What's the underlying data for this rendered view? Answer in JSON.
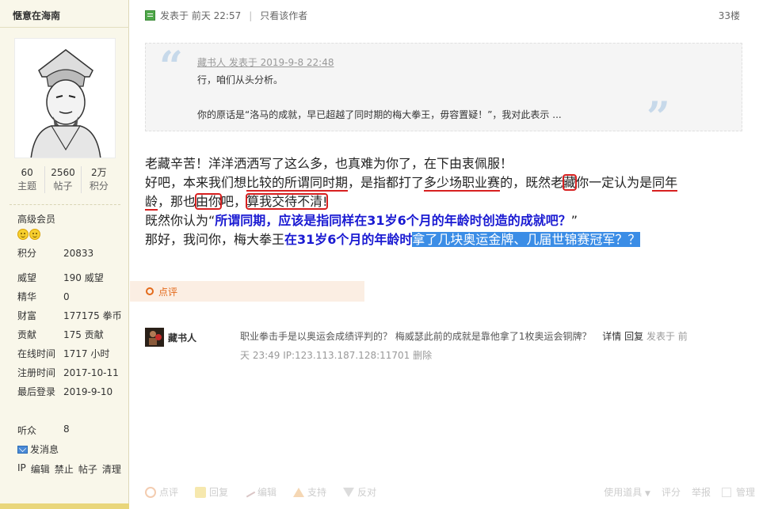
{
  "sidebar": {
    "username": "惬意在海南",
    "stats": [
      {
        "num": "60",
        "label": "主题"
      },
      {
        "num": "2560",
        "label": "帖子"
      },
      {
        "num": "2万",
        "label": "积分"
      }
    ],
    "level": "高级会员",
    "info": [
      {
        "k": "积分",
        "v": "20833"
      },
      {
        "k": "威望",
        "v": "190 威望"
      },
      {
        "k": "精华",
        "v": "0"
      },
      {
        "k": "财富",
        "v": "177175 拳币"
      },
      {
        "k": "贡献",
        "v": "175 贡献"
      },
      {
        "k": "在线时间",
        "v": "1717 小时"
      },
      {
        "k": "注册时间",
        "v": "2017-10-11"
      },
      {
        "k": "最后登录",
        "v": "2019-9-10"
      }
    ],
    "listeners": {
      "k": "听众",
      "v": "8"
    },
    "send_message": "发消息",
    "admin_links": [
      "IP",
      "编辑",
      "禁止",
      "帖子",
      "清理"
    ]
  },
  "post": {
    "posted_at": "发表于 前天 22:57",
    "only_author": "只看该作者",
    "floor": "33楼",
    "quote": {
      "header": "藏书人 发表于 2019-9-8 22:48",
      "line1": "行，咱们从头分析。",
      "line2": "你的原话是“洛马的成就，早已超越了同时期的梅大拳王，毋容置疑！”，我对此表示 ..."
    },
    "body": {
      "l1": "老藏辛苦！洋洋洒洒写了这么多，也真难为你了，在下由衷佩服！",
      "l2_a": "好吧，本来我们想",
      "l2_b": "比较的所谓同时期",
      "l2_c": "，是指都打了",
      "l2_d": "多少场职业赛",
      "l2_e": "的，既然",
      "l2_f": "老",
      "l2_g": "藏",
      "l2_h": "你一定认为是",
      "l2_i": "同年",
      "l3_a": "龄",
      "l3_b": "，那也",
      "l3_c": "由你",
      "l3_d": "吧，",
      "l3_e": "算我交待不清!",
      "l4_a": "既然你认为“",
      "l4_b": "所谓同期，应该是指同样在31岁6个月的年龄时创造的成就吧？",
      "l4_c": "”",
      "l5_a": "那好，我问你，梅大拳王",
      "l5_b": "在31岁6个月的年龄时",
      "l5_c": "拿了几块奥运金牌、几届世锦赛冠军？？"
    },
    "review_label": "点评",
    "comment": {
      "user": "藏书人",
      "text": "职业拳击手是以奥运会成绩评判的？ 梅威瑟此前的成就是靠他拿了1枚奥运会铜牌？",
      "detail": "详情",
      "reply": "回复",
      "posted_prefix": "发表于 前",
      "line2": "天 23:49 IP:123.113.187.128:11701 删除"
    },
    "actions": [
      {
        "label": "点评",
        "icon": "review-icon"
      },
      {
        "label": "回复",
        "icon": "reply-icon"
      },
      {
        "label": "编辑",
        "icon": "edit-icon"
      },
      {
        "label": "支持",
        "icon": "thumbs-up-icon"
      },
      {
        "label": "反对",
        "icon": "thumbs-down-icon"
      }
    ],
    "tools": "使用道具",
    "rate": "评分",
    "report": "举报",
    "manage": "管理"
  }
}
